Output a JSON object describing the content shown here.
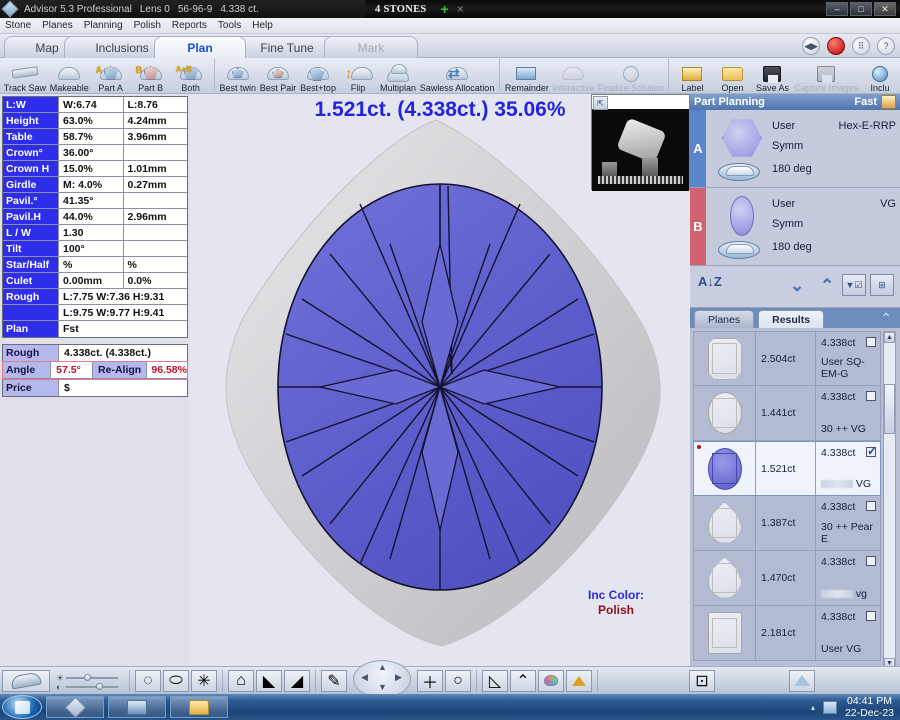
{
  "window": {
    "app_title": "Advisor 5.3 Professional",
    "lens": "Lens 0",
    "stone_code": "56-96-9",
    "carat": "4.338 ct.",
    "doc_title": "4 STONES",
    "add_tab": "+",
    "close_tab": "×",
    "minimize": "–",
    "maximize": "□",
    "close": "✕"
  },
  "menu": {
    "items": [
      "Stone",
      "Planes",
      "Planning",
      "Polish",
      "Reports",
      "Tools",
      "Help"
    ]
  },
  "tabs": {
    "items": [
      {
        "label": "Map",
        "state": "normal"
      },
      {
        "label": "Inclusions",
        "state": "normal"
      },
      {
        "label": "Plan",
        "state": "active"
      },
      {
        "label": "Fine Tune",
        "state": "normal"
      },
      {
        "label": "Mark",
        "state": "dim"
      }
    ],
    "right_buttons": [
      {
        "name": "nav-left-right",
        "glyph": "◀▶"
      },
      {
        "name": "record",
        "glyph": ""
      },
      {
        "name": "grid",
        "glyph": "⠿"
      },
      {
        "name": "help",
        "glyph": "?"
      }
    ]
  },
  "ribbon": {
    "items": [
      {
        "label": "Track Saw",
        "icon": "saw-icon",
        "disabled": false
      },
      {
        "label": "Makeable",
        "icon": "dome-icon",
        "disabled": false
      },
      {
        "label": "Part A",
        "icon": "gem-a-icon",
        "badge": "A",
        "disabled": false
      },
      {
        "label": "Part B",
        "icon": "gem-b-icon",
        "badge": "B",
        "disabled": false
      },
      {
        "label": "Both",
        "icon": "gem-ab-icon",
        "badge": "A+B",
        "disabled": false
      },
      {
        "label": "Best twin",
        "icon": "twin-icon",
        "disabled": false
      },
      {
        "label": "Best Pair",
        "icon": "pair-icon",
        "disabled": false
      },
      {
        "label": "Best+top",
        "icon": "best-top-icon",
        "disabled": false
      },
      {
        "label": "Flip",
        "icon": "flip-icon",
        "disabled": false
      },
      {
        "label": "Multiplan",
        "icon": "multiplan-icon",
        "disabled": false
      },
      {
        "label": "Sawless Allocation",
        "icon": "sawless-icon",
        "disabled": false
      },
      {
        "label": "Remainder",
        "icon": "remainder-icon",
        "disabled": false
      },
      {
        "label": "Interactive",
        "icon": "interactive-icon",
        "disabled": true
      },
      {
        "label": "Finalize Solution",
        "icon": "finalize-icon",
        "disabled": true
      },
      {
        "label": "Label",
        "icon": "label-icon",
        "disabled": false
      },
      {
        "label": "Open",
        "icon": "folder-icon",
        "disabled": false
      },
      {
        "label": "Save As",
        "icon": "disk-icon",
        "disabled": false
      },
      {
        "label": "Capture Images",
        "icon": "capture-icon",
        "disabled": true
      },
      {
        "label": "Inclu",
        "icon": "globe-icon",
        "disabled": false
      }
    ]
  },
  "params": {
    "expand_button_glyph": "⇱",
    "rows": [
      {
        "key": "L:W",
        "v1": "W:6.74",
        "v2": "L:8.76"
      },
      {
        "key": "Height",
        "v1": "63.0%",
        "v2": "4.24mm"
      },
      {
        "key": "Table",
        "v1": "58.7%",
        "v2": "3.96mm"
      },
      {
        "key": "Crown°",
        "v1": "36.00°",
        "v2": ""
      },
      {
        "key": "Crown H",
        "v1": "15.0%",
        "v2": "1.01mm"
      },
      {
        "key": "Girdle",
        "v1": "M: 4.0%",
        "v2": "0.27mm"
      },
      {
        "key": "Pavil.°",
        "v1": "41.35°",
        "v2": ""
      },
      {
        "key": "Pavil.H",
        "v1": "44.0%",
        "v2": "2.96mm"
      },
      {
        "key": "L / W",
        "v1": "1.30",
        "v2": ""
      },
      {
        "key": "Tilt",
        "v1": "100°",
        "v2": ""
      },
      {
        "key": "Star/Half",
        "v1": "%",
        "v2": "%"
      },
      {
        "key": "Culet",
        "v1": "0.00mm",
        "v2": "0.0%"
      },
      {
        "key": "Rough",
        "v1": "L:7.75 W:7.36 H:9.31",
        "v2": "",
        "span": true
      },
      {
        "key": "",
        "v1": "L:9.75 W:9.77 H:9.41",
        "v2": "",
        "span": true
      },
      {
        "key": "Plan",
        "v1": "Fst",
        "v2": "",
        "span": true
      }
    ]
  },
  "summary": {
    "rough_label": "Rough",
    "rough_value": "4.338ct. (4.338ct.)",
    "angle_label": "Angle",
    "angle_value": "57.5°",
    "realign_label": "Re-Align",
    "realign_value": "96.58%",
    "price_label": "Price",
    "price_value": "$"
  },
  "viewport": {
    "title": "1.521ct. (4.338ct.) 35.06%",
    "inc_color_label": "Inc Color:",
    "inc_color_value": "Polish",
    "expand_glyph": "⇱"
  },
  "part_planning": {
    "title": "Part Planning",
    "mode": "Fast",
    "parts": [
      {
        "band": "A",
        "shape": "hex",
        "user_label": "User",
        "user_value": "Hex-E-RRP",
        "symm_label": "Symm",
        "deg": "180 deg"
      },
      {
        "band": "B",
        "shape": "oval",
        "user_label": "User",
        "user_value": "VG",
        "symm_label": "Symm",
        "deg": "180 deg"
      }
    ],
    "sort_glyph": "A↓Z",
    "down_glyph": "⌄",
    "up_glyph": "⌃"
  },
  "subtabs": {
    "items": [
      {
        "label": "Planes",
        "active": false
      },
      {
        "label": "Results",
        "active": true
      }
    ],
    "collapse_glyph": "⌃"
  },
  "results": {
    "rows": [
      {
        "shape": "emerald",
        "ct": "2.504ct",
        "rough": "4.338ct",
        "desc": "User SQ-EM-G",
        "checked": false,
        "selected": false,
        "blurred": false
      },
      {
        "shape": "round",
        "ct": "1.441ct",
        "rough": "4.338ct",
        "desc": "30 ++  VG",
        "checked": false,
        "selected": false,
        "blurred": false
      },
      {
        "shape": "oval",
        "ct": "1.521ct",
        "rough": "4.338ct",
        "desc": "VG",
        "checked": true,
        "selected": true,
        "blurred": true
      },
      {
        "shape": "pear",
        "ct": "1.387ct",
        "rough": "4.338ct",
        "desc": "30 ++  Pear E",
        "checked": false,
        "selected": false,
        "blurred": false
      },
      {
        "shape": "pear",
        "ct": "1.470ct",
        "rough": "4.338ct",
        "desc": "vg",
        "checked": false,
        "selected": false,
        "blurred": true
      },
      {
        "shape": "square",
        "ct": "2.181ct",
        "rough": "4.338ct",
        "desc": "User VG",
        "checked": false,
        "selected": false,
        "blurred": false
      }
    ],
    "scroll_up_glyph": "▲",
    "scroll_down_glyph": "▼"
  },
  "bottom_toolbar": {
    "buttons": [
      {
        "name": "view-stone",
        "glyph": ""
      },
      {
        "name": "brightness-slider",
        "glyph": ""
      },
      {
        "name": "rotate-view",
        "glyph": "◌"
      },
      {
        "name": "side-view",
        "glyph": "⬭"
      },
      {
        "name": "facet-view",
        "glyph": "✳"
      },
      {
        "name": "dome-view",
        "glyph": "⌂"
      },
      {
        "name": "plane-left",
        "glyph": "◣"
      },
      {
        "name": "plane-right",
        "glyph": "◢"
      },
      {
        "name": "paint-view",
        "glyph": "✎"
      },
      {
        "name": "navigation-pad",
        "glyph": ""
      },
      {
        "name": "zoom-in",
        "glyph": "＋"
      },
      {
        "name": "zoom-fit",
        "glyph": "○"
      },
      {
        "name": "measure",
        "glyph": "◺"
      },
      {
        "name": "up-arrow",
        "glyph": "⌃"
      },
      {
        "name": "palette",
        "glyph": "🎨"
      },
      {
        "name": "highlight",
        "glyph": "▲"
      },
      {
        "name": "snapshot",
        "glyph": "⊡"
      },
      {
        "name": "home-view",
        "glyph": "⌂"
      }
    ]
  },
  "taskbar": {
    "start_label": "",
    "tasks": [
      {
        "name": "advisor-task",
        "icon": "diamond-icon"
      },
      {
        "name": "display-task",
        "icon": "monitor-icon"
      },
      {
        "name": "explorer-task",
        "icon": "folder-icon"
      }
    ],
    "tray_arrow": "▴",
    "time": "04:41 PM",
    "date": "22-Dec-23"
  }
}
